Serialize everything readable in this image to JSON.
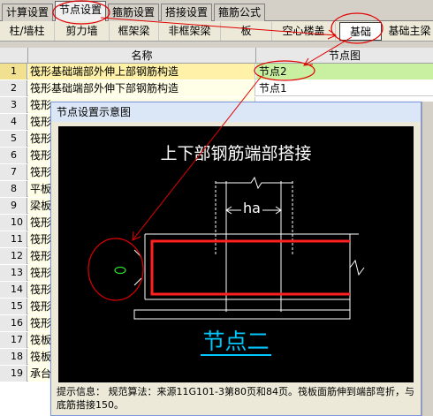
{
  "top_tabs": [
    "计算设置",
    "节点设置",
    "箍筋设置",
    "搭接设置",
    "箍筋公式"
  ],
  "sub_tabs": [
    "柱/墙柱",
    "剪力墙",
    "框架梁",
    "非框架梁",
    "板",
    "空心楼盖",
    "基础",
    "基础主梁"
  ],
  "grid": {
    "headers": {
      "name": "名称",
      "node": "节点图"
    },
    "rows": [
      {
        "n": "1",
        "name": "筏形基础端部外伸上部钢筋构造",
        "node": "节点2"
      },
      {
        "n": "2",
        "name": "筏形基础端部外伸下部钢筋构造",
        "node": "节点1"
      },
      {
        "n": "3",
        "name": "筏形",
        "node": ""
      },
      {
        "n": "4",
        "name": "筏形",
        "node": ""
      },
      {
        "n": "5",
        "name": "筏形",
        "node": ""
      },
      {
        "n": "6",
        "name": "筏形",
        "node": ""
      },
      {
        "n": "7",
        "name": "筏形",
        "node": ""
      },
      {
        "n": "8",
        "name": "平板",
        "node": ""
      },
      {
        "n": "9",
        "name": "梁板",
        "node": ""
      },
      {
        "n": "10",
        "name": "筏形",
        "node": ""
      },
      {
        "n": "11",
        "name": "筏形",
        "node": ""
      },
      {
        "n": "12",
        "name": "筏形",
        "node": ""
      },
      {
        "n": "13",
        "name": "筏形",
        "node": ""
      },
      {
        "n": "14",
        "name": "筏形",
        "node": ""
      },
      {
        "n": "15",
        "name": "筏形",
        "node": ""
      },
      {
        "n": "16",
        "name": "筏形",
        "node": ""
      },
      {
        "n": "17",
        "name": "筏板",
        "node": ""
      },
      {
        "n": "18",
        "name": "筏板",
        "node": ""
      },
      {
        "n": "19",
        "name": "承台",
        "node": ""
      }
    ]
  },
  "popup": {
    "title": "节点设置示意图",
    "diagram_title": "上下部钢筋端部搭接",
    "dim_label": "ha",
    "node_label": "节点二",
    "hint": "提示信息：  规范算法：来源11G101-3第80页和84页。筏板面筋伸到端部弯折，与底筋搭接150。"
  },
  "colors": {
    "accent_red": "#e00000",
    "selected_row": "#fff2a8",
    "node_cell": "#c8f0a0",
    "diagram_cyan": "#00c8ff"
  }
}
